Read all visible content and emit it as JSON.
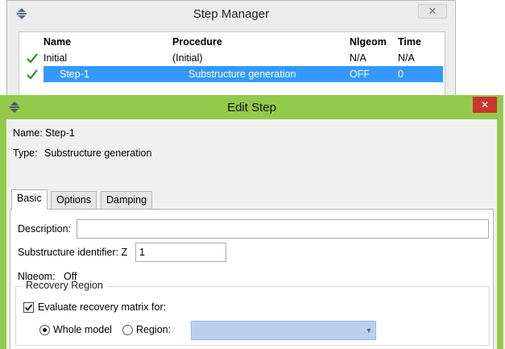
{
  "step_manager": {
    "title": "Step Manager",
    "close_glyph": "✕",
    "columns": [
      "Name",
      "Procedure",
      "Nlgeom",
      "Time"
    ],
    "rows": [
      {
        "name": "Initial",
        "procedure": "(Initial)",
        "nlgeom": "N/A",
        "time": "N/A",
        "status_icon": "check-icon"
      },
      {
        "name": "Step-1",
        "procedure": "Substructure generation",
        "nlgeom": "OFF",
        "time": "0",
        "status_icon": "check-icon",
        "selected": true
      }
    ],
    "check_color": "#2a8a2a",
    "selection_color": "#3399ff"
  },
  "edit_step": {
    "title": "Edit Step",
    "close_glyph": "✕",
    "name_label": "Name:",
    "name_value": "Step-1",
    "type_label": "Type:",
    "type_value": "Substructure generation",
    "tabs": [
      {
        "label": "Basic",
        "active": true
      },
      {
        "label": "Options",
        "active": false
      },
      {
        "label": "Damping",
        "active": false
      }
    ],
    "basic": {
      "description_label": "Description:",
      "description_value": "",
      "substructure_label": "Substructure identifier: Z",
      "substructure_value": "1",
      "nlgeom_label": "Nlgeom:",
      "nlgeom_value": "Off",
      "recovery_region": {
        "legend": "Recovery Region",
        "evaluate_label": "Evaluate recovery matrix for:",
        "evaluate_checked": true,
        "whole_model_label": "Whole model",
        "whole_model_selected": true,
        "region_label": "Region:",
        "region_selected": false,
        "region_value": ""
      }
    },
    "title_bar_color": "#93c94a",
    "close_button_color": "#c7362f"
  }
}
